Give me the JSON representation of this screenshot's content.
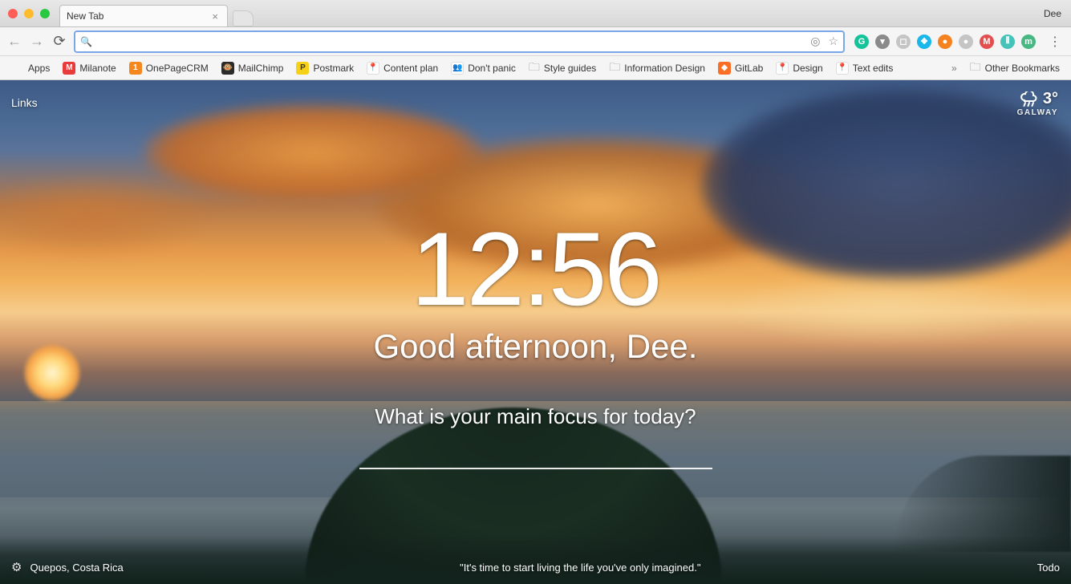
{
  "titlebar": {
    "tab_title": "New Tab",
    "profile_name": "Dee"
  },
  "omnibox": {
    "value": ""
  },
  "bookmarks": {
    "items": [
      {
        "label": "Apps",
        "icon": "apps",
        "color": "transparent"
      },
      {
        "label": "Milanote",
        "icon": "M",
        "color": "#e83b3b"
      },
      {
        "label": "OnePageCRM",
        "icon": "1",
        "color": "#f5871f"
      },
      {
        "label": "MailChimp",
        "icon": "🐵",
        "color": "#2b2b2b"
      },
      {
        "label": "Postmark",
        "icon": "P",
        "color": "#f7d117"
      },
      {
        "label": "Content plan",
        "icon": "📍",
        "color": "#fff"
      },
      {
        "label": "Don't panic",
        "icon": "👥",
        "color": "#fff"
      },
      {
        "label": "Style guides",
        "icon": "folder",
        "color": ""
      },
      {
        "label": "Information Design",
        "icon": "folder",
        "color": ""
      },
      {
        "label": "GitLab",
        "icon": "◆",
        "color": "#fc6d26"
      },
      {
        "label": "Design",
        "icon": "📍",
        "color": "#fff"
      },
      {
        "label": "Text edits",
        "icon": "📍",
        "color": "#fff"
      }
    ],
    "other_label": "Other Bookmarks"
  },
  "extensions": [
    {
      "name": "grammarly",
      "color": "#15c39a",
      "glyph": "G"
    },
    {
      "name": "pocket",
      "color": "#8a8a8a",
      "glyph": "▾"
    },
    {
      "name": "readlater",
      "color": "#c5c5c5",
      "glyph": "◻"
    },
    {
      "name": "buffer",
      "color": "#1ab7ea",
      "glyph": "❖"
    },
    {
      "name": "ext-orange",
      "color": "#f58220",
      "glyph": "●"
    },
    {
      "name": "ext-gray",
      "color": "#c5c5c5",
      "glyph": "●"
    },
    {
      "name": "ext-red",
      "color": "#e34f4f",
      "glyph": "M"
    },
    {
      "name": "ext-teal",
      "color": "#45c3b8",
      "glyph": "⦀"
    },
    {
      "name": "ext-green",
      "color": "#47b881",
      "glyph": "m"
    }
  ],
  "momentum": {
    "links_label": "Links",
    "weather": {
      "temp": "3°",
      "location": "GALWAY"
    },
    "clock": "12:56",
    "greeting": "Good afternoon, Dee.",
    "focus_prompt": "What is your main focus for today?",
    "focus_value": "",
    "location": "Quepos, Costa Rica",
    "quote": "\"It's time to start living the life you've only imagined.\"",
    "todo_label": "Todo"
  }
}
